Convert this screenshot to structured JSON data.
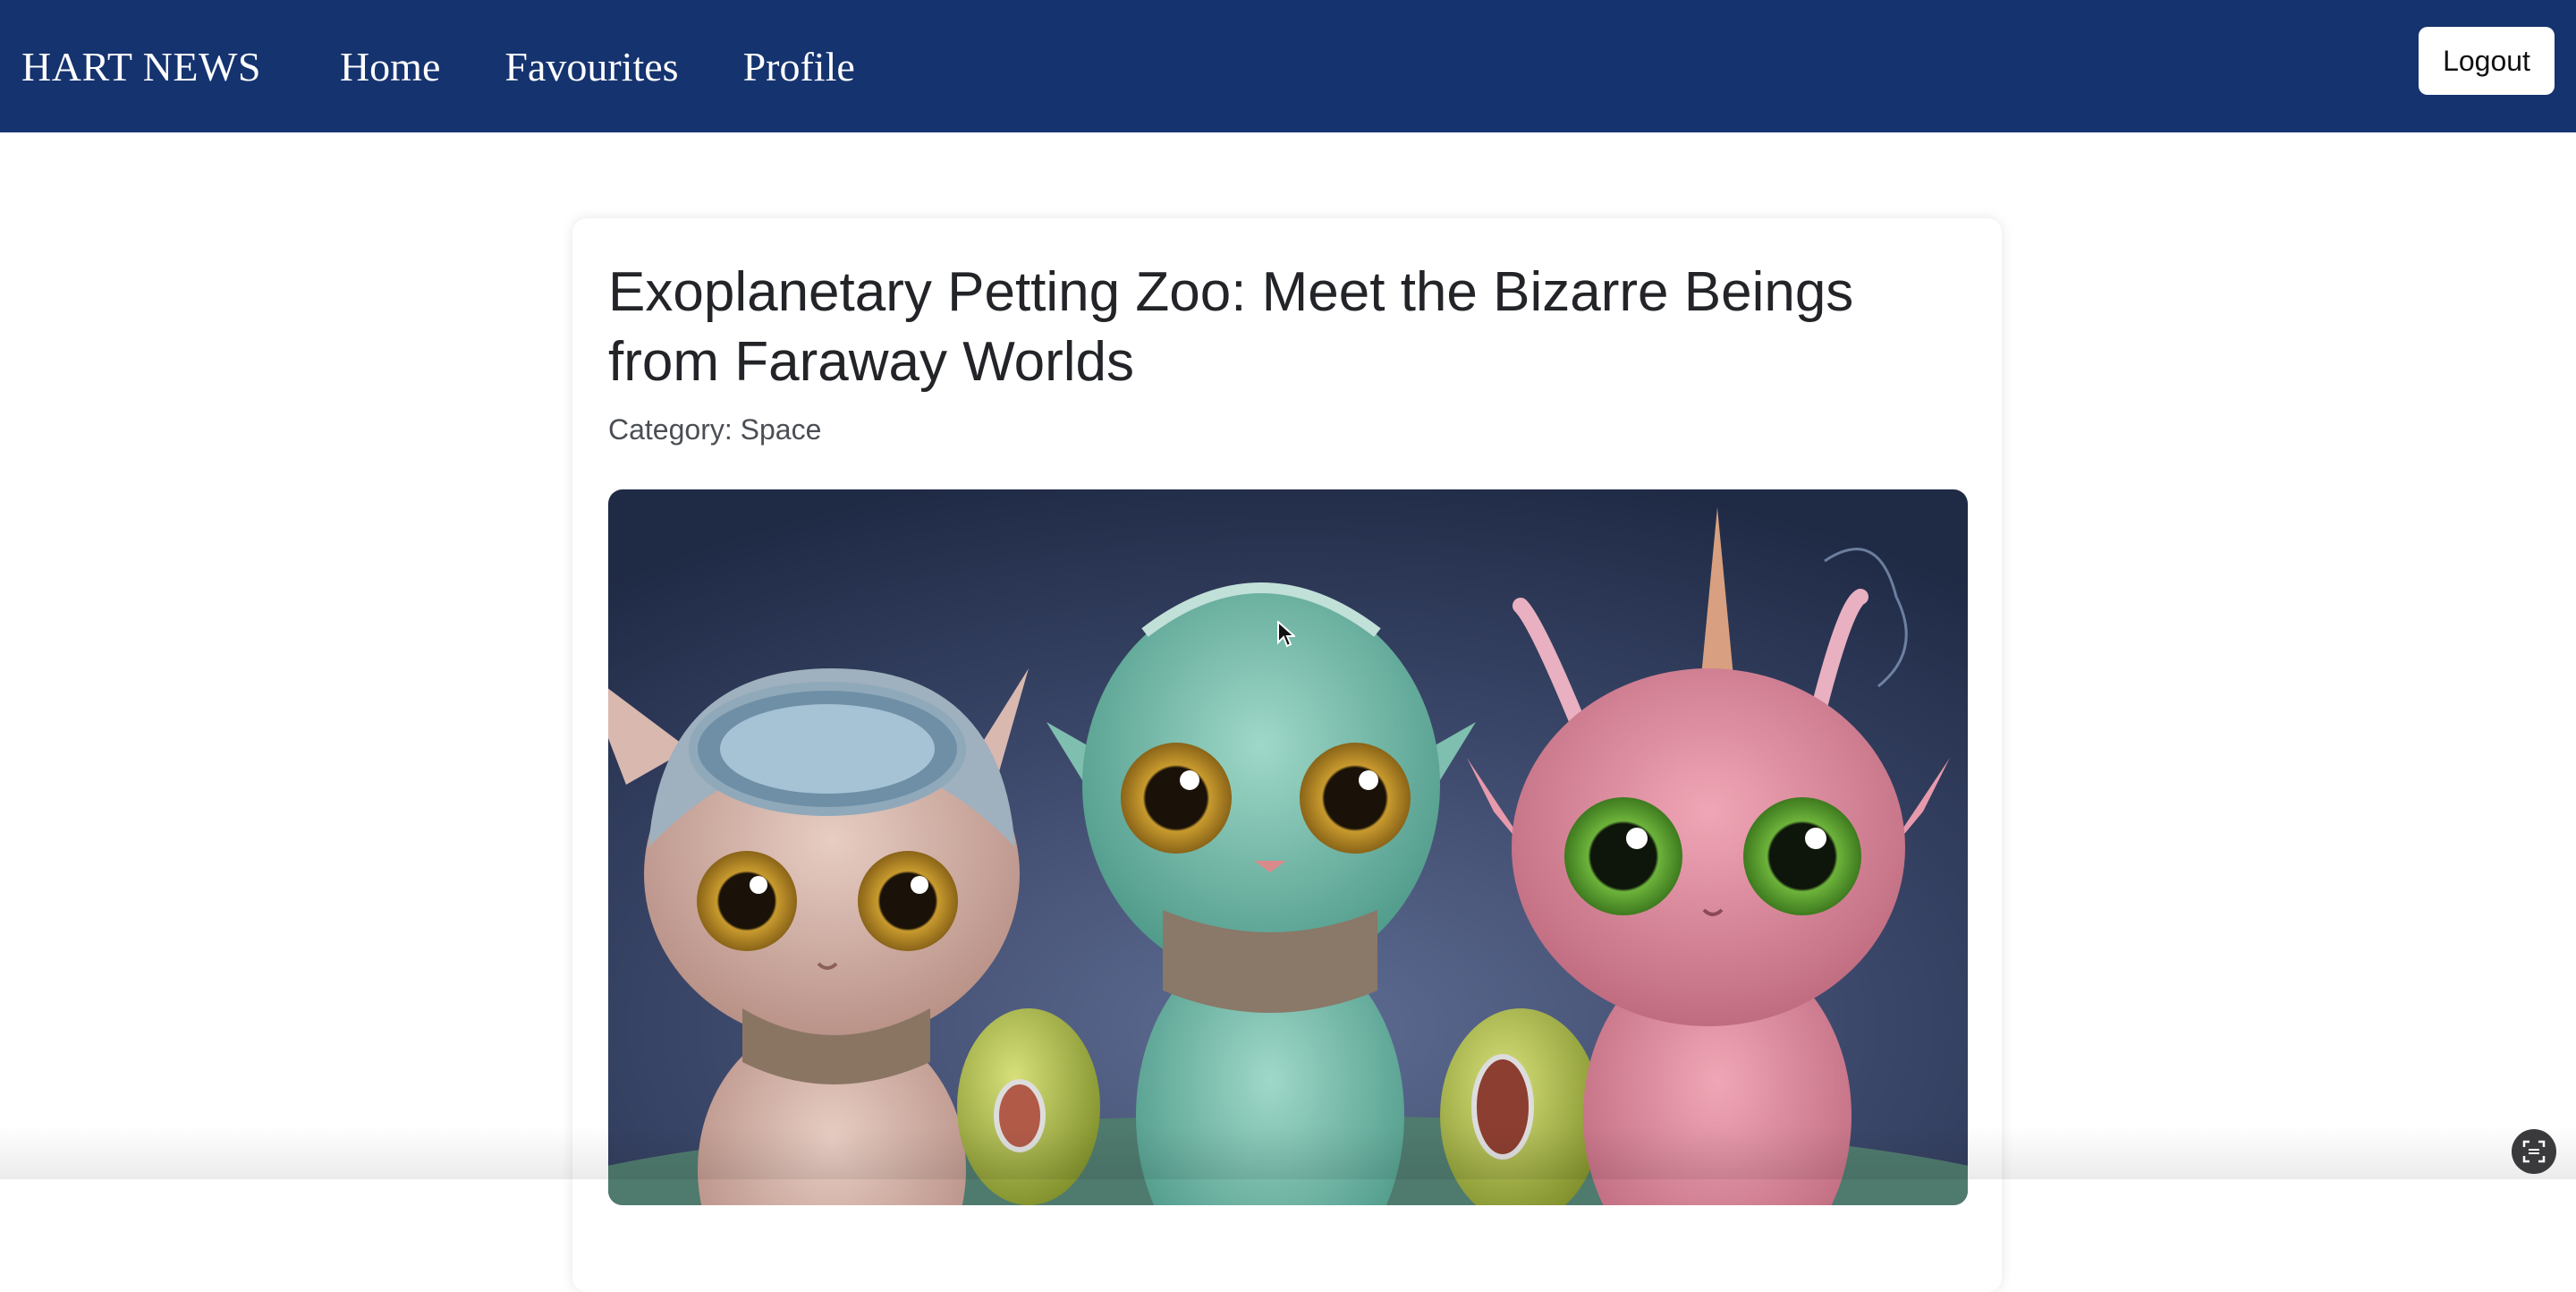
{
  "header": {
    "brand": "HART NEWS",
    "nav": [
      {
        "label": "Home"
      },
      {
        "label": "Favourites"
      },
      {
        "label": "Profile"
      }
    ],
    "logout_label": "Logout",
    "background_color": "#15336f"
  },
  "article": {
    "title": "Exoplanetary Petting Zoo: Meet the Bizarre Beings from Faraway Worlds",
    "category": "Category: Space",
    "image_icon": "alien-creatures-image"
  },
  "overlay": {
    "corner_icon": "screen-capture-icon"
  }
}
